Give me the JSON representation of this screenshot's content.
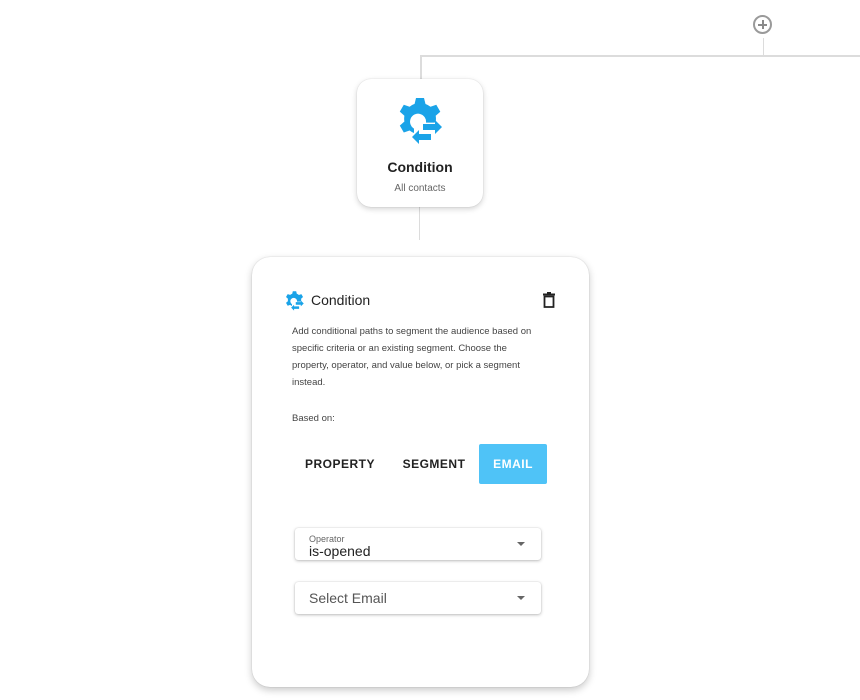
{
  "node": {
    "title": "Condition",
    "subtitle": "All contacts",
    "icon": "gear-swap-icon"
  },
  "panel": {
    "title": "Condition",
    "icon": "gear-swap-icon",
    "delete_icon": "trash-icon",
    "description": "Add conditional paths to segment the audience based on specific criteria or an existing segment. Choose the property, operator, and value below, or pick a segment instead.",
    "based_on_label": "Based on:",
    "tabs": [
      {
        "label": "PROPERTY",
        "active": false
      },
      {
        "label": "SEGMENT",
        "active": false
      },
      {
        "label": "EMAIL",
        "active": true
      }
    ],
    "operator": {
      "label": "Operator",
      "value": "is-opened"
    },
    "email_select": {
      "placeholder": "Select Email"
    }
  },
  "colors": {
    "accent": "#29b6f6",
    "active_tab": "#4fc3f7"
  }
}
